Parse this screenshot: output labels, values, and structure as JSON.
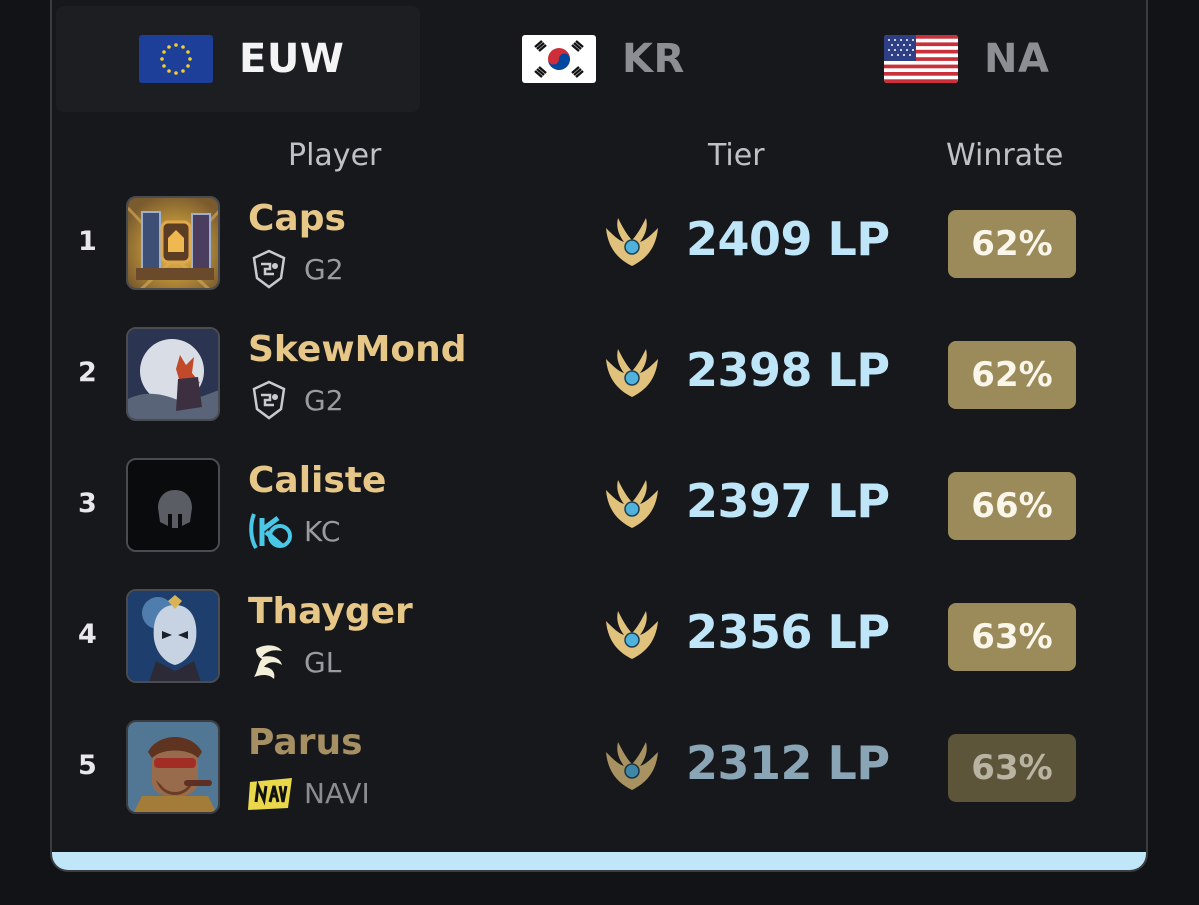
{
  "tabs": [
    {
      "label": "EUW",
      "flag": "eu-flag",
      "active": true
    },
    {
      "label": "KR",
      "flag": "kr-flag",
      "active": false
    },
    {
      "label": "NA",
      "flag": "us-flag",
      "active": false
    }
  ],
  "columns": {
    "player": "Player",
    "tier": "Tier",
    "winrate": "Winrate"
  },
  "rows": [
    {
      "rank": "1",
      "name": "Caps",
      "team": "G2",
      "team_logo": "g2-logo-icon",
      "avatar": "champion-avatar",
      "tier_icon": "master-tier-icon",
      "lp": "2409 LP",
      "winrate": "62%"
    },
    {
      "rank": "2",
      "name": "SkewMond",
      "team": "G2",
      "team_logo": "g2-logo-icon",
      "avatar": "champion-avatar",
      "tier_icon": "master-tier-icon",
      "lp": "2398 LP",
      "winrate": "62%"
    },
    {
      "rank": "3",
      "name": "Caliste",
      "team": "KC",
      "team_logo": "kc-logo-icon",
      "avatar": "champion-avatar",
      "tier_icon": "master-tier-icon",
      "lp": "2397 LP",
      "winrate": "66%"
    },
    {
      "rank": "4",
      "name": "Thayger",
      "team": "GL",
      "team_logo": "gl-logo-icon",
      "avatar": "champion-avatar",
      "tier_icon": "master-tier-icon",
      "lp": "2356 LP",
      "winrate": "63%"
    },
    {
      "rank": "5",
      "name": "Parus",
      "team": "NAVI",
      "team_logo": "navi-logo-icon",
      "avatar": "champion-avatar",
      "tier_icon": "master-tier-icon",
      "lp": "2312 LP",
      "winrate": "63%"
    }
  ],
  "colors": {
    "background": "#121316",
    "card": "#17181b",
    "player_name": "#e7c787",
    "lp": "#bfe6f8",
    "winrate_badge": "#9b8a5a",
    "accent_bar": "#bfe7f7"
  }
}
